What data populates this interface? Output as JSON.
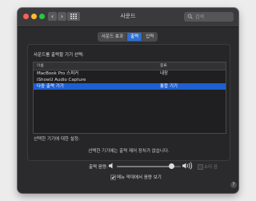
{
  "window": {
    "title": "사운드"
  },
  "search": {
    "placeholder": "검색"
  },
  "tabs": [
    {
      "label": "사운드 효과",
      "active": false
    },
    {
      "label": "출력",
      "active": true
    },
    {
      "label": "입력",
      "active": false
    }
  ],
  "output": {
    "section_label": "사운드를 출력할 기기 선택:",
    "columns": {
      "name": "이름",
      "type": "종류"
    },
    "devices": [
      {
        "name": "MacBook Pro 스피커",
        "type": "내장",
        "selected": false
      },
      {
        "name": "iShowU Audio Capture",
        "type": "",
        "selected": false
      },
      {
        "name": "다중 출력 기기",
        "type": "통합 기기",
        "selected": true
      }
    ],
    "settings_label": "선택한 기기에 대한 설정:",
    "no_settings_text": "선택한 기기에는 출력 제어 장치가 없습니다."
  },
  "volume": {
    "label": "출력 음량:",
    "level": 0.85,
    "mute_label": "소리 끔",
    "mute_checked": false,
    "mute_enabled": false
  },
  "menubar": {
    "label": "메뉴 막대에서 음량 보기",
    "checked": true
  },
  "colors": {
    "accent": "#2f6fd4",
    "selection": "#1f5fd1",
    "window_bg": "#2b2b2d",
    "traffic_red": "#fe5f57",
    "traffic_yellow": "#febc2e",
    "traffic_green": "#28c840"
  },
  "icons": {
    "back": "chevron-left-icon",
    "forward": "chevron-right-icon",
    "grid": "grid-icon",
    "search": "search-icon",
    "volume_low": "speaker-low-icon",
    "volume_high": "speaker-high-icon",
    "help": "question-mark-icon"
  }
}
